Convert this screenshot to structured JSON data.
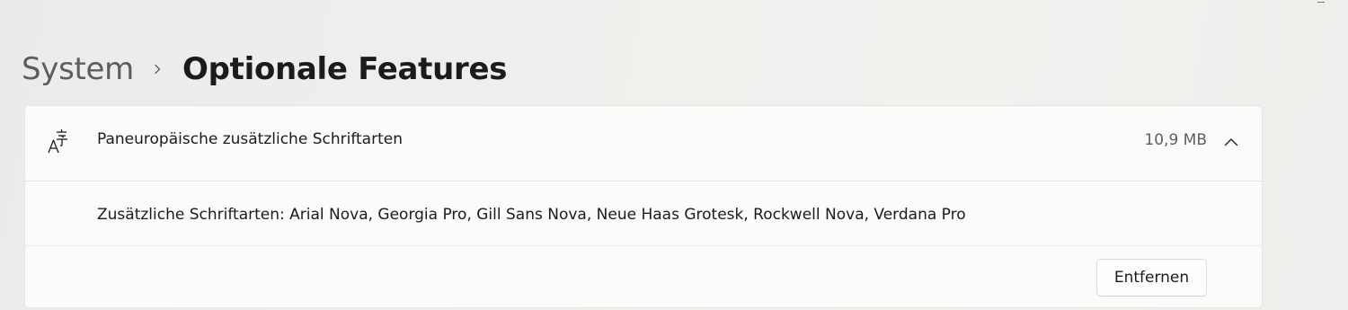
{
  "breadcrumb": {
    "parent": "System",
    "separator_icon": "chevron-right-icon",
    "current": "Optionale Features"
  },
  "feature": {
    "icon": "font-language-icon",
    "name": "Paneuropäische zusätzliche Schriftarten",
    "size": "10,9 MB",
    "expand_icon": "chevron-up-icon",
    "expanded": true,
    "details": "Zusätzliche Schriftarten: Arial Nova, Georgia Pro, Gill Sans Nova, Neue Haas Grotesk, Rockwell Nova, Verdana Pro",
    "remove_label": "Entfernen"
  },
  "colors": {
    "card_background": "#fbfbfa",
    "text_primary": "#1b1b1b",
    "text_secondary": "#5e5e5e"
  }
}
